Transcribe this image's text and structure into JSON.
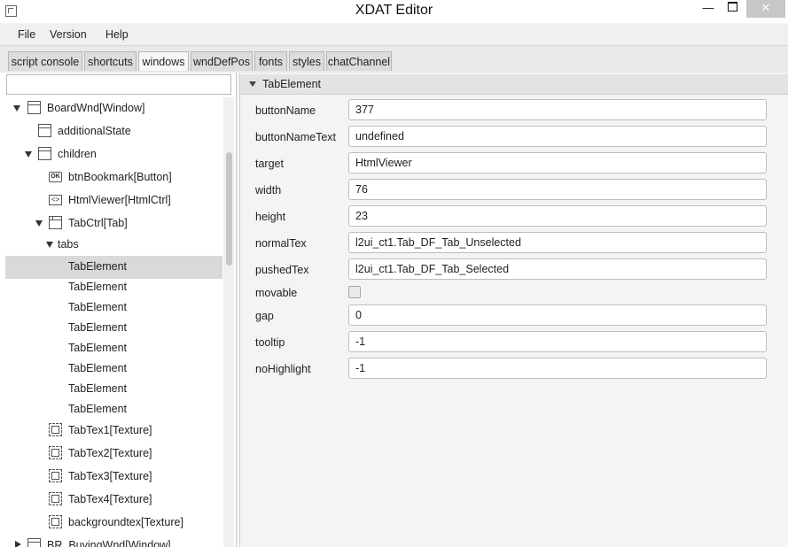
{
  "window": {
    "title": "XDAT Editor",
    "minimize_glyph": "—",
    "close_glyph": "✕"
  },
  "menu": [
    "File",
    "Version",
    "Help"
  ],
  "tabs": [
    {
      "label": "script console",
      "active": false
    },
    {
      "label": "shortcuts",
      "active": false
    },
    {
      "label": "windows",
      "active": true
    },
    {
      "label": "wndDefPos",
      "active": false
    },
    {
      "label": "fonts",
      "active": false
    },
    {
      "label": "styles",
      "active": false
    },
    {
      "label": "chatChannel",
      "active": false
    }
  ],
  "search": {
    "value": ""
  },
  "tree": [
    {
      "label": "BoardWnd[Window]",
      "icon": "window-icon",
      "expanded": true
    },
    {
      "label": "additionalState",
      "icon": "window-icon"
    },
    {
      "label": "children",
      "icon": "window-icon",
      "expanded": true
    },
    {
      "label": "btnBookmark[Button]",
      "icon": "button-icon",
      "icon_text": "OK"
    },
    {
      "label": "HtmlViewer[HtmlCtrl]",
      "icon": "html-icon",
      "icon_text": "<>"
    },
    {
      "label": "TabCtrl[Tab]",
      "icon": "tab-icon",
      "expanded": true
    },
    {
      "label": "tabs",
      "icon": "",
      "expanded": true
    },
    {
      "label": "TabElement",
      "icon": "",
      "selected": true
    },
    {
      "label": "TabElement",
      "icon": ""
    },
    {
      "label": "TabElement",
      "icon": ""
    },
    {
      "label": "TabElement",
      "icon": ""
    },
    {
      "label": "TabElement",
      "icon": ""
    },
    {
      "label": "TabElement",
      "icon": ""
    },
    {
      "label": "TabElement",
      "icon": ""
    },
    {
      "label": "TabElement",
      "icon": ""
    },
    {
      "label": "TabTex1[Texture]",
      "icon": "texture-icon"
    },
    {
      "label": "TabTex2[Texture]",
      "icon": "texture-icon"
    },
    {
      "label": "TabTex3[Texture]",
      "icon": "texture-icon"
    },
    {
      "label": "TabTex4[Texture]",
      "icon": "texture-icon"
    },
    {
      "label": "backgroundtex[Texture]",
      "icon": "texture-icon"
    },
    {
      "label": "BR_BuyingWnd[Window]",
      "icon": "window-icon",
      "expanded": false
    }
  ],
  "properties": {
    "section_title": "TabElement",
    "fields": [
      {
        "name": "buttonName",
        "value": "377",
        "type": "text"
      },
      {
        "name": "buttonNameText",
        "value": "undefined",
        "type": "text"
      },
      {
        "name": "target",
        "value": "HtmlViewer",
        "type": "text"
      },
      {
        "name": "width",
        "value": "76",
        "type": "text"
      },
      {
        "name": "height",
        "value": "23",
        "type": "text"
      },
      {
        "name": "normalTex",
        "value": "l2ui_ct1.Tab_DF_Tab_Unselected",
        "type": "text"
      },
      {
        "name": "pushedTex",
        "value": "l2ui_ct1.Tab_DF_Tab_Selected",
        "type": "text"
      },
      {
        "name": "movable",
        "value": false,
        "type": "checkbox"
      },
      {
        "name": "gap",
        "value": "0",
        "type": "text"
      },
      {
        "name": "tooltip",
        "value": "-1",
        "type": "text"
      },
      {
        "name": "noHighlight",
        "value": "-1",
        "type": "text"
      }
    ]
  }
}
